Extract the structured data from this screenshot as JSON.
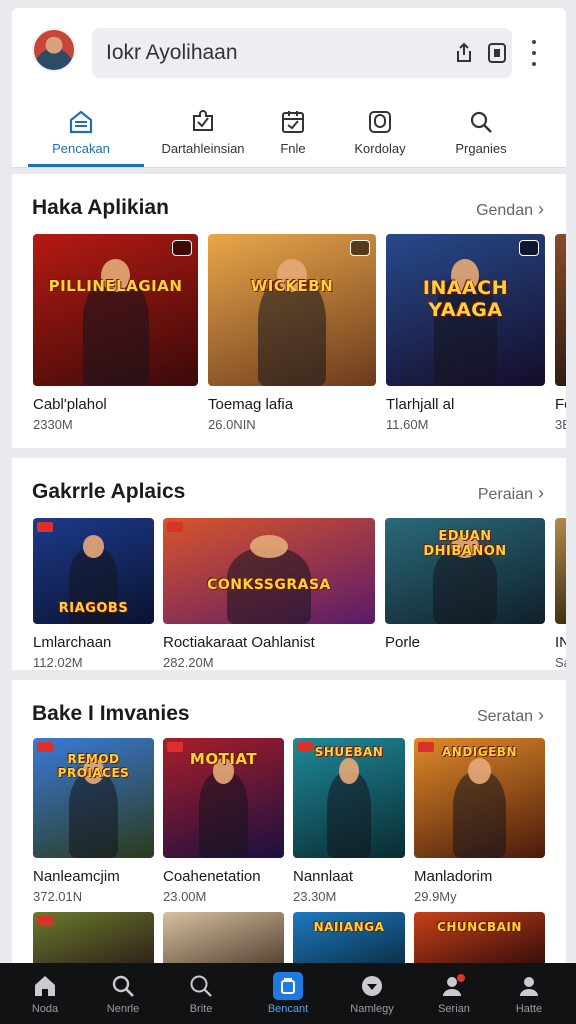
{
  "header": {
    "search_text": "Iokr Ayolihaan",
    "icons": [
      "share-icon",
      "bookmark-icon",
      "more-vertical-icon"
    ]
  },
  "tabs": [
    {
      "label": "Pencakan",
      "icon": "home-icon",
      "active": true
    },
    {
      "label": "Dartahleinsian",
      "icon": "puzzle-icon",
      "active": false
    },
    {
      "label": "Fnle",
      "icon": "calendar-icon",
      "active": false
    },
    {
      "label": "Kordolay",
      "icon": "gamepad-icon",
      "active": false
    },
    {
      "label": "Prganies",
      "icon": "search-icon",
      "active": false
    }
  ],
  "sections": [
    {
      "title": "Haka Aplikian",
      "link": "Gendan",
      "cards": [
        {
          "name": "Cabl'plahol",
          "size": "2330M",
          "logo": "PILLINELAGIAN",
          "bg": [
            "#b51a12",
            "#3a0a0a"
          ]
        },
        {
          "name": "Toemag lafia",
          "size": "26.0NIN",
          "logo": "WICKEBN",
          "bg": [
            "#e9a64a",
            "#6b3b1d"
          ]
        },
        {
          "name": "Tlarhjall al",
          "size": "11.60M",
          "logo": "INAACH YAAGA",
          "bg": [
            "#284a8a",
            "#150c2a"
          ]
        },
        {
          "name": "Fe",
          "size": "3E",
          "logo": "",
          "bg": [
            "#8a4b2a",
            "#2a1a10"
          ]
        }
      ]
    },
    {
      "title": "Gakrrle Aplaics",
      "link": "Peraian",
      "cards": [
        {
          "name": "Lmlarchaan",
          "size": "112.02M",
          "logo": "RIAGOBS",
          "bg": [
            "#1d3a8a",
            "#0a1230"
          ]
        },
        {
          "name": "Roctiakaraat Oahlanist",
          "size": "282.20M",
          "logo": "CONKSSGRASA",
          "bg": [
            "#d8552a",
            "#5a1a6a"
          ]
        },
        {
          "name": "Porle",
          "size": "",
          "logo": "EDUAN DHIBANON",
          "bg": [
            "#2a6a7a",
            "#10202a"
          ]
        },
        {
          "name": "IN",
          "size": "Sa",
          "logo": "",
          "bg": [
            "#b08a4a",
            "#3a2a10"
          ]
        }
      ]
    },
    {
      "title": "Bake I Imvanies",
      "link": "Seratan",
      "cards": [
        {
          "name": "Nanleamcjim",
          "size": "372.01N",
          "logo": "REMOD PROIACES",
          "bg": [
            "#3a7ad8",
            "#2a3a1a"
          ]
        },
        {
          "name": "Coahenetation",
          "size": "23.00M",
          "logo": "MOTIAT",
          "bg": [
            "#a81e2a",
            "#1a1040"
          ]
        },
        {
          "name": "Nannlaat",
          "size": "23.30M",
          "logo": "SHUEBAN",
          "bg": [
            "#1e8a9a",
            "#0a2a30"
          ]
        },
        {
          "name": "Manladorim",
          "size": "29.9My",
          "logo": "ANDIGEBN",
          "bg": [
            "#e08a2a",
            "#4a1a0a"
          ]
        }
      ]
    }
  ],
  "partial_row": [
    {
      "logo": "",
      "bg": [
        "#6a7a2a",
        "#2a1a1a"
      ]
    },
    {
      "logo": "",
      "bg": [
        "#d8c0a0",
        "#4a3a2a"
      ]
    },
    {
      "logo": "NAIIANGA",
      "bg": [
        "#1e7ac0",
        "#0a2a40"
      ]
    },
    {
      "logo": "CHUNCBAIN",
      "bg": [
        "#c8401a",
        "#2a0a0a"
      ]
    }
  ],
  "bottom_nav": [
    {
      "label": "Noda",
      "icon": "home-icon",
      "active": false
    },
    {
      "label": "Nenrle",
      "icon": "search-icon",
      "active": false
    },
    {
      "label": "Brite",
      "icon": "search-icon",
      "active": false
    },
    {
      "label": "Bencant",
      "icon": "apps-icon",
      "active": true
    },
    {
      "label": "Namlegy",
      "icon": "shield-icon",
      "active": false
    },
    {
      "label": "Serian",
      "icon": "profile-notification-icon",
      "active": false
    },
    {
      "label": "Hatte",
      "icon": "profile-icon",
      "active": false
    }
  ]
}
